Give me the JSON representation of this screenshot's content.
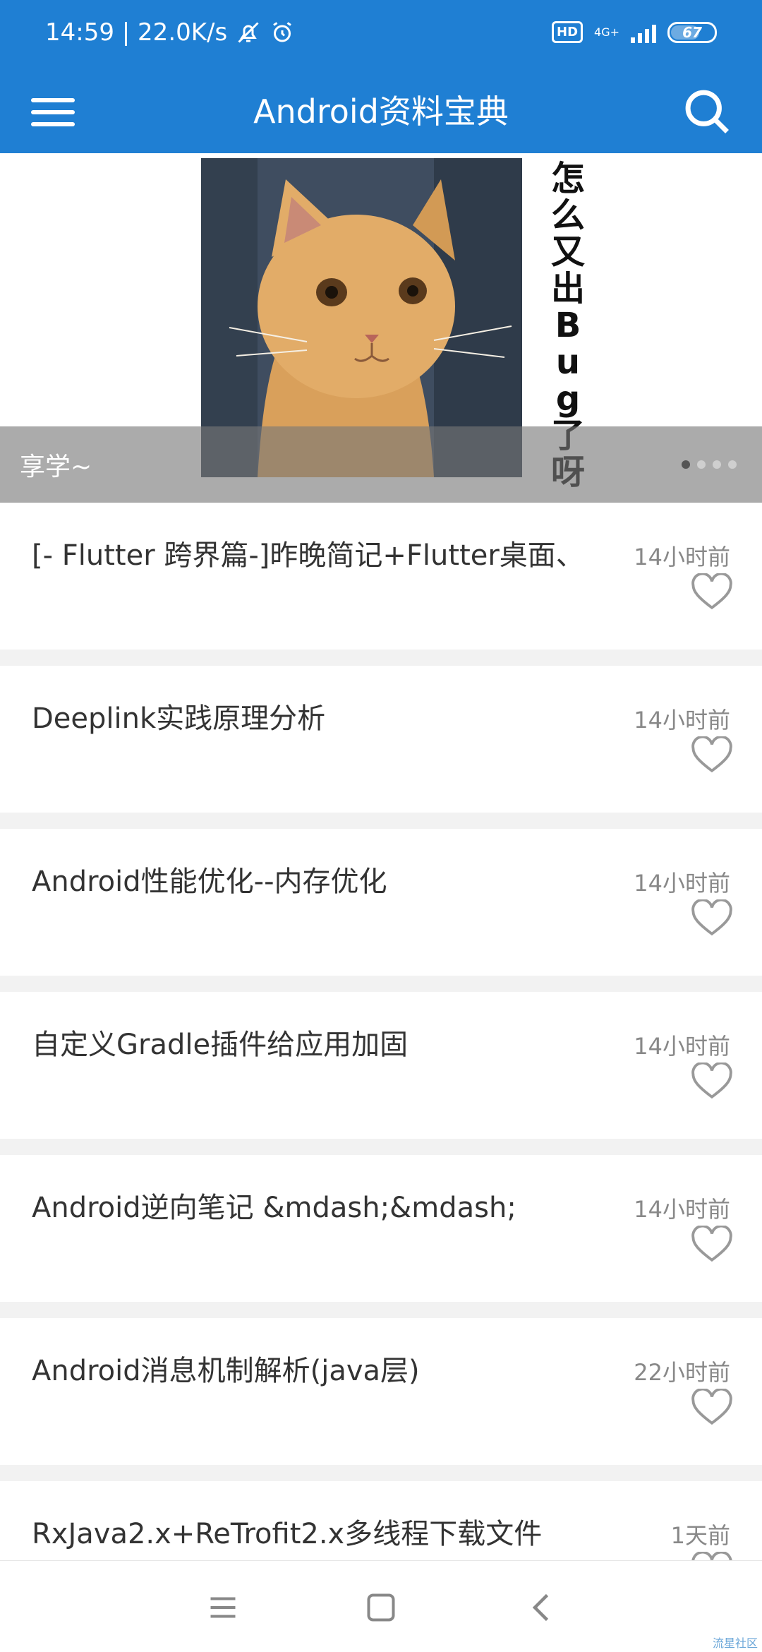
{
  "status_bar": {
    "time_speed": "14:59 | 22.0K/s",
    "network_type": "4G+",
    "hd_label": "HD",
    "battery": "67"
  },
  "toolbar": {
    "title": "Android资料宝典",
    "menu_icon": "hamburger-menu-icon",
    "search_icon": "search-icon"
  },
  "banner": {
    "caption": "享学~",
    "vertical_text": "怎么又出Bug了呀",
    "page_count": 4,
    "active_page": 1
  },
  "articles": [
    {
      "title": "[- Flutter 跨界篇-]昨晚简记+Flutter桌面、",
      "time": "14小时前"
    },
    {
      "title": "Deeplink实践原理分析",
      "time": "14小时前"
    },
    {
      "title": "Android性能优化--内存优化",
      "time": "14小时前"
    },
    {
      "title": "自定义Gradle插件给应用加固",
      "time": "14小时前"
    },
    {
      "title": "Android逆向笔记 &mdash;&mdash;",
      "time": "14小时前"
    },
    {
      "title": "Android消息机制解析(java层)",
      "time": "22小时前"
    },
    {
      "title": "RxJava2.x+ReTrofit2.x多线程下载文件",
      "time": "1天前"
    }
  ],
  "watermark": "流星社区",
  "colors": {
    "primary": "#1f7fd3",
    "list_bg": "#f2f2f2"
  }
}
